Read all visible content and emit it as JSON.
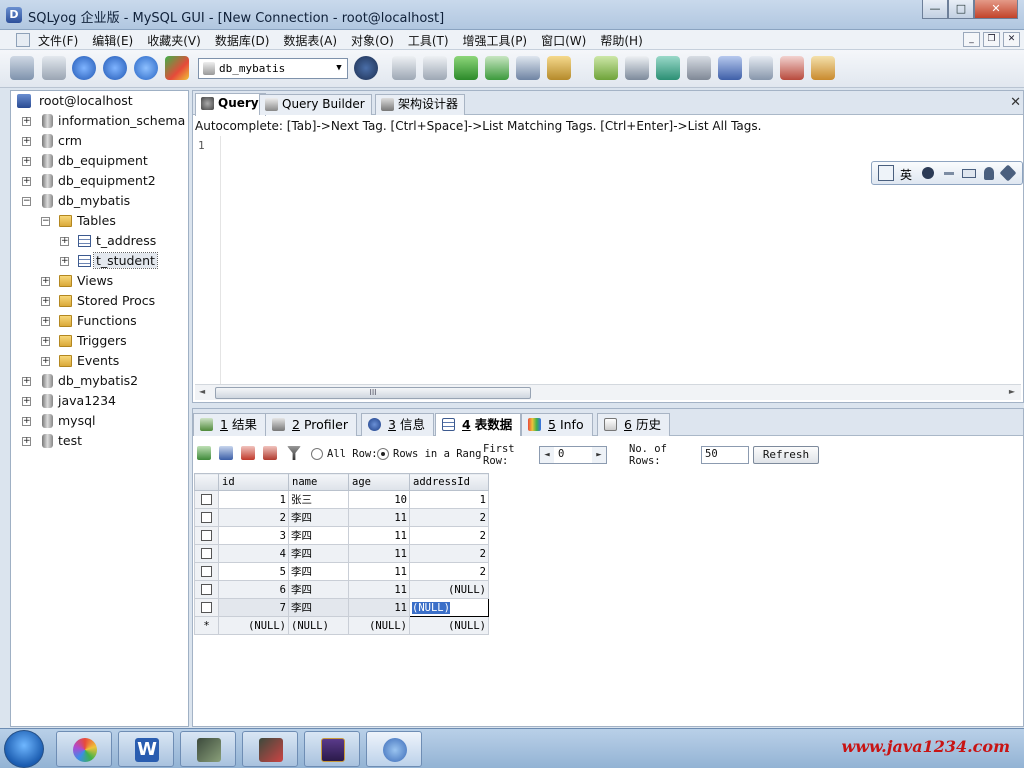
{
  "window": {
    "title": "SQLyog 企业版 - MySQL GUI - [New Connection - root@localhost]",
    "buttons": {
      "minimize": "—",
      "maximize": "□",
      "close": "✕"
    }
  },
  "menu": [
    "文件(F)",
    "编辑(E)",
    "收藏夹(V)",
    "数据库(D)",
    "数据表(A)",
    "对象(O)",
    "工具(T)",
    "增强工具(P)",
    "窗口(W)",
    "帮助(H)"
  ],
  "mdi_buttons": {
    "minimize": "_",
    "restore": "❐",
    "close": "✕"
  },
  "toolbar": {
    "database_select": "db_mybatis",
    "dropdown_arrow": "▼"
  },
  "tree": {
    "root": "root@localhost",
    "items": [
      {
        "label": "information_schema",
        "type": "db",
        "expander": "+"
      },
      {
        "label": "crm",
        "type": "db",
        "expander": "+"
      },
      {
        "label": "db_equipment",
        "type": "db",
        "expander": "+"
      },
      {
        "label": "db_equipment2",
        "type": "db",
        "expander": "+"
      },
      {
        "label": "db_mybatis",
        "type": "db",
        "expander": "−"
      },
      {
        "label": "Tables",
        "type": "folder",
        "expander": "−"
      },
      {
        "label": "t_address",
        "type": "table",
        "expander": "+"
      },
      {
        "label": "t_student",
        "type": "table",
        "expander": "+"
      },
      {
        "label": "Views",
        "type": "folder",
        "expander": "+"
      },
      {
        "label": "Stored Procs",
        "type": "folder",
        "expander": "+"
      },
      {
        "label": "Functions",
        "type": "folder",
        "expander": "+"
      },
      {
        "label": "Triggers",
        "type": "folder",
        "expander": "+"
      },
      {
        "label": "Events",
        "type": "folder",
        "expander": "+"
      },
      {
        "label": "db_mybatis2",
        "type": "db",
        "expander": "+"
      },
      {
        "label": "java1234",
        "type": "db",
        "expander": "+"
      },
      {
        "label": "mysql",
        "type": "db",
        "expander": "+"
      },
      {
        "label": "test",
        "type": "db",
        "expander": "+"
      }
    ]
  },
  "query_tabs": [
    "Query",
    "Query Builder",
    "架构设计器"
  ],
  "panel_close": "✕",
  "autocomplete": "Autocomplete: [Tab]->Next Tag. [Ctrl+Space]->List Matching Tags. [Ctrl+Enter]->List All Tags.",
  "editor": {
    "line_number": "1"
  },
  "ime": {
    "label": "英"
  },
  "scroll": {
    "left": "◄",
    "right": "►",
    "grip": "III"
  },
  "result_tabs": [
    {
      "num": "1",
      "label": "结果"
    },
    {
      "num": "2",
      "label": "Profiler"
    },
    {
      "num": "3",
      "label": "信息"
    },
    {
      "num": "4",
      "label": "表数据"
    },
    {
      "num": "5",
      "label": "Info"
    },
    {
      "num": "6",
      "label": "历史"
    }
  ],
  "result_toolbar": {
    "all_rows": "All Row:",
    "rows_in_range": "Rows in a Rang",
    "first_row": "First Row:",
    "first_row_value": "0",
    "no_of_rows": "No. of Rows:",
    "no_of_rows_value": "50",
    "refresh": "Refresh",
    "spin_left": "◄",
    "spin_right": "►"
  },
  "grid": {
    "columns": [
      "id",
      "name",
      "age",
      "addressId"
    ],
    "rows": [
      [
        "1",
        "张三",
        "10",
        "1"
      ],
      [
        "2",
        "李四",
        "11",
        "2"
      ],
      [
        "3",
        "李四",
        "11",
        "2"
      ],
      [
        "4",
        "李四",
        "11",
        "2"
      ],
      [
        "5",
        "李四",
        "11",
        "2"
      ],
      [
        "6",
        "李四",
        "11",
        "(NULL)"
      ],
      [
        "7",
        "李四",
        "11",
        "(NULL)"
      ]
    ],
    "new_row_marker": "*",
    "new_row": [
      "(NULL)",
      "(NULL)",
      "(NULL)",
      "(NULL)"
    ]
  },
  "taskbar": {
    "watermark": "www.java1234.com"
  }
}
